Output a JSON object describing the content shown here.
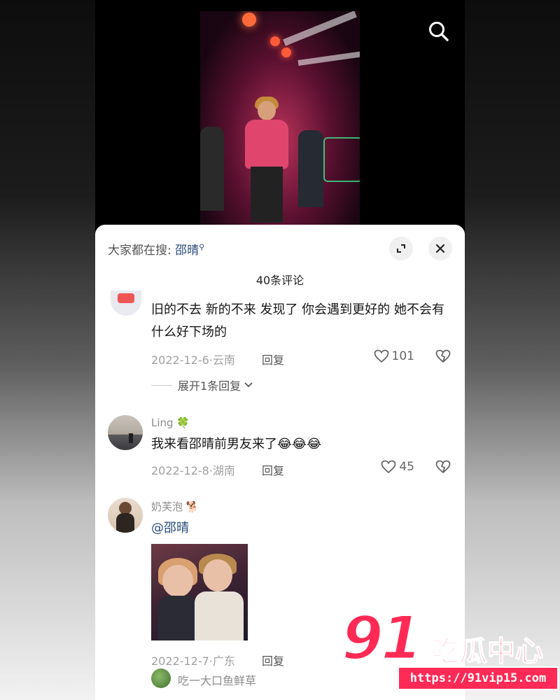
{
  "panel": {
    "trending_prefix": "大家都在搜:",
    "trending_keyword": "邵晴",
    "comment_count": "40条评论"
  },
  "comments": [
    {
      "username": "",
      "text": "旧的不去 新的不来 发现了 你会遇到更好的 她不会有什么好下场的",
      "date_location": "2022-12-6·云南",
      "reply_label": "回复",
      "likes": "101",
      "expand_replies": "展开1条回复"
    },
    {
      "username": "Ling",
      "username_emoji": "🍀",
      "text": "我来看邵晴前男友来了",
      "text_emoji": "😂😂😂",
      "date_location": "2022-12-8·湖南",
      "reply_label": "回复",
      "likes": "45"
    },
    {
      "username": "奶芙泡",
      "username_emoji": "🐕",
      "text": "@邵晴",
      "date_location": "2022-12-7·广东",
      "reply_label": "回复"
    },
    {
      "username": "吃一大口鱼鲜草"
    }
  ],
  "watermark": {
    "logo_number": "91",
    "logo_text": "吃瓜中心",
    "url": "https://91vip15.com"
  },
  "colors": {
    "accent_link": "#2a4d7a",
    "watermark": "#ff2a55"
  },
  "icons": [
    "search-icon",
    "expand-icon",
    "close-icon",
    "heart-icon",
    "dislike-heart-icon",
    "chevron-down-icon"
  ]
}
